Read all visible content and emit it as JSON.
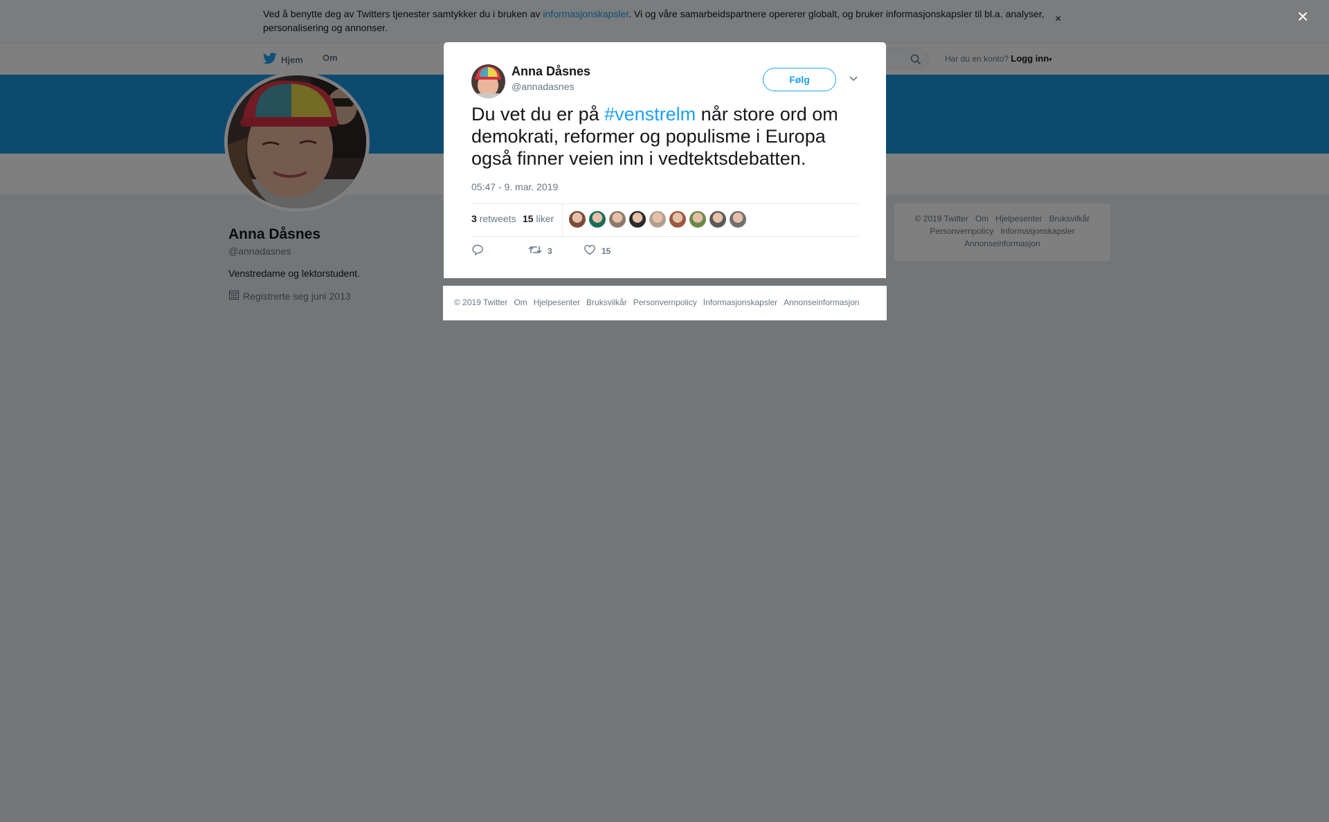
{
  "cookie_bar": {
    "text_before": "Ved å benytte deg av Twitters tjenester samtykker du i bruken av ",
    "link": "informasjonskapsler",
    "text_after": ". Vi og våre samarbeidspartnere opererer globalt, og bruker informasjonskapsler til bl.a. analyser, personalisering og annonser.",
    "close": "×"
  },
  "nav": {
    "home": "Hjem",
    "about": "Om",
    "login_prompt": "Har du en konto?",
    "login": "Logg inn"
  },
  "profile": {
    "name": "Anna Dåsnes",
    "handle": "@annadasnes",
    "bio": "Venstredame og lektorstudent.",
    "joined": "Registrerte seg juni 2013"
  },
  "side_footer": {
    "items": [
      "© 2019 Twitter",
      "Om",
      "Hjelpesenter",
      "Bruksvilkår",
      "Personvernpolicy",
      "Informasjonskapsler",
      "Annonseinformasjon"
    ]
  },
  "overlay": {
    "close": "×"
  },
  "tweet": {
    "author_name": "Anna Dåsnes",
    "author_handle": "@annadasnes",
    "follow_label": "Følg",
    "text_before": "Du vet du er på ",
    "hashtag": "#venstrelm",
    "text_after": " når store ord om demokrati, reformer og populisme i Europa også finner veien inn i vedtektsdebatten.",
    "timestamp": "05:47 - 9. mar. 2019",
    "retweets_count": "3",
    "retweets_label": "retweets",
    "likes_count": "15",
    "likes_label": "liker",
    "action_retweet_count": "3",
    "action_like_count": "15",
    "likers": [
      {
        "color": "#7a4b3a"
      },
      {
        "color": "#1b6d5a"
      },
      {
        "color": "#8a7a6a"
      },
      {
        "color": "#2a2a2a"
      },
      {
        "color": "#b0a090"
      },
      {
        "color": "#9a5a40"
      },
      {
        "color": "#6a8a4a"
      },
      {
        "color": "#5a5a5a"
      },
      {
        "color": "#707070"
      }
    ]
  },
  "modal_footer": {
    "items": [
      "© 2019 Twitter",
      "Om",
      "Hjelpesenter",
      "Bruksvilkår",
      "Personvernpolicy",
      "Informasjonskapsler",
      "Annonseinformasjon"
    ]
  },
  "colors": {
    "brand_blue": "#1da1f2",
    "banner": "#1b95e0",
    "overlay": "rgba(0,0,0,0.5)"
  }
}
